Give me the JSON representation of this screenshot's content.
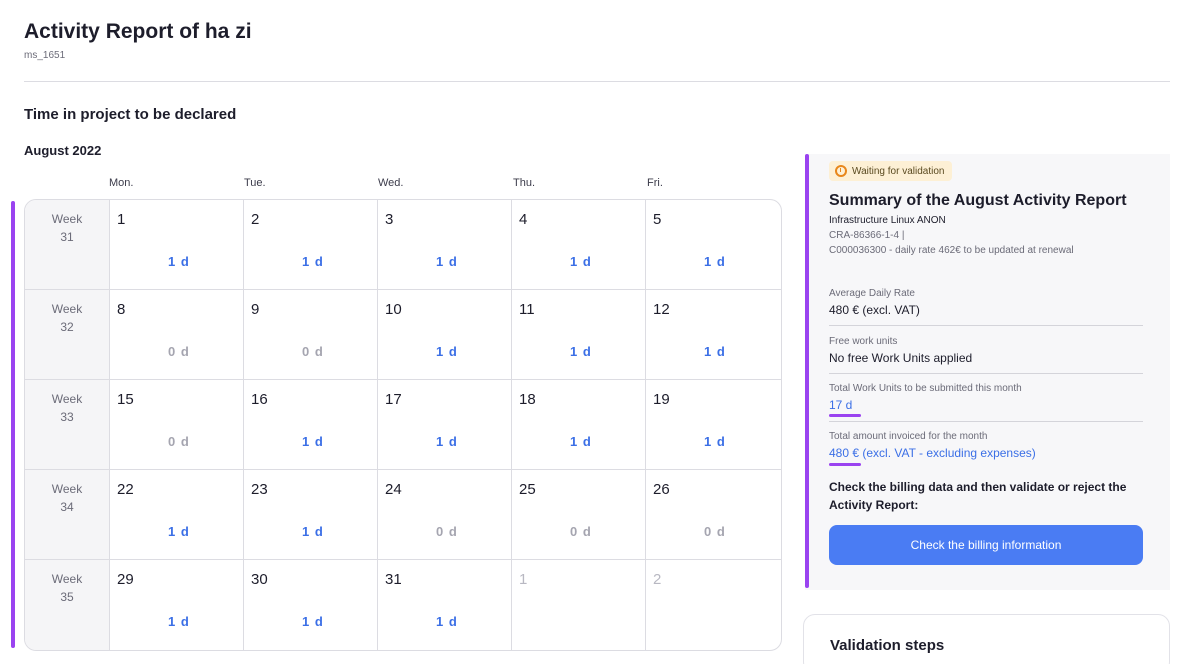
{
  "header": {
    "title": "Activity Report of ha zi",
    "subtitle": "ms_1651"
  },
  "section_title": "Time in project to be declared",
  "month_title": "August 2022",
  "day_headers": [
    "Mon.",
    "Tue.",
    "Wed.",
    "Thu.",
    "Fri."
  ],
  "weeks": [
    {
      "label": "Week",
      "number": "31",
      "days": [
        {
          "num": "1",
          "value": "1 d"
        },
        {
          "num": "2",
          "value": "1 d"
        },
        {
          "num": "3",
          "value": "1 d"
        },
        {
          "num": "4",
          "value": "1 d"
        },
        {
          "num": "5",
          "value": "1 d"
        }
      ]
    },
    {
      "label": "Week",
      "number": "32",
      "days": [
        {
          "num": "8",
          "value": "0 d"
        },
        {
          "num": "9",
          "value": "0 d"
        },
        {
          "num": "10",
          "value": "1 d"
        },
        {
          "num": "11",
          "value": "1 d"
        },
        {
          "num": "12",
          "value": "1 d"
        }
      ]
    },
    {
      "label": "Week",
      "number": "33",
      "days": [
        {
          "num": "15",
          "value": "0 d"
        },
        {
          "num": "16",
          "value": "1 d"
        },
        {
          "num": "17",
          "value": "1 d"
        },
        {
          "num": "18",
          "value": "1 d"
        },
        {
          "num": "19",
          "value": "1 d"
        }
      ]
    },
    {
      "label": "Week",
      "number": "34",
      "days": [
        {
          "num": "22",
          "value": "1 d"
        },
        {
          "num": "23",
          "value": "1 d"
        },
        {
          "num": "24",
          "value": "0 d"
        },
        {
          "num": "25",
          "value": "0 d"
        },
        {
          "num": "26",
          "value": "0 d"
        }
      ]
    },
    {
      "label": "Week",
      "number": "35",
      "days": [
        {
          "num": "29",
          "value": "1 d"
        },
        {
          "num": "30",
          "value": "1 d"
        },
        {
          "num": "31",
          "value": "1 d"
        },
        {
          "num": "1",
          "value": "",
          "muted": true
        },
        {
          "num": "2",
          "value": "",
          "muted": true
        }
      ]
    }
  ],
  "summary": {
    "status_badge": "Waiting for validation",
    "status_icon": "timer-icon",
    "title": "Summary of the August Activity Report",
    "project": "Infrastructure Linux ANON",
    "contract": "CRA-86366-1-4 |",
    "note": "C000036300 - daily rate 462€ to be updated at renewal",
    "fields": [
      {
        "label": "Average Daily Rate",
        "value": "480 € (excl. VAT)",
        "link": false
      },
      {
        "label": "Free work units",
        "value": "No free Work Units applied",
        "link": false
      },
      {
        "label": "Total Work Units to be submitted this month",
        "value": "17 d",
        "link": true
      },
      {
        "label": "Total amount invoiced for the month",
        "value": "480 € (excl. VAT - excluding expenses)",
        "link": true
      }
    ],
    "check_text": "Check the billing data and then validate or reject the Activity Report:",
    "billing_button": "Check the billing information"
  },
  "validation": {
    "title": "Validation steps"
  },
  "colors": {
    "accent": "#9a43f0",
    "primary": "#4a7cf3",
    "link": "#3b6fe6",
    "badge_bg": "#fdf0d5"
  }
}
